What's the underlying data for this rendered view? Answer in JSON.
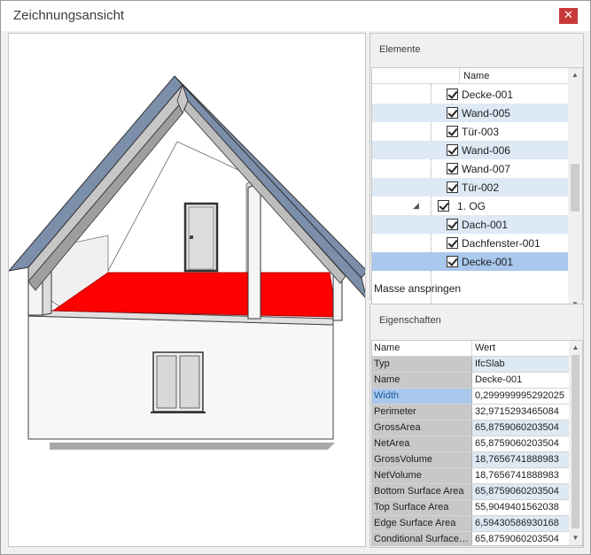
{
  "window": {
    "title": "Zeichnungsansicht",
    "close_glyph": "✕"
  },
  "colors": {
    "accent_selection": "#a9c8ec",
    "alternate_row": "#dde9f5",
    "selected_slab": "#ff0000",
    "roof": "#7b8eaa",
    "close_button": "#c8393a"
  },
  "elements": {
    "title": "Elemente",
    "column_name": "Name",
    "rows": [
      {
        "label": "Decke-001",
        "checked": true,
        "level": 2,
        "style": "plain"
      },
      {
        "label": "Wand-005",
        "checked": true,
        "level": 2,
        "style": "alt"
      },
      {
        "label": "Tür-003",
        "checked": true,
        "level": 2,
        "style": "plain"
      },
      {
        "label": "Wand-006",
        "checked": true,
        "level": 2,
        "style": "alt"
      },
      {
        "label": "Wand-007",
        "checked": true,
        "level": 2,
        "style": "plain"
      },
      {
        "label": "Tür-002",
        "checked": true,
        "level": 2,
        "style": "alt"
      },
      {
        "label": "1. OG",
        "checked": true,
        "level": 1,
        "style": "plain",
        "expander": "◢"
      },
      {
        "label": "Dach-001",
        "checked": true,
        "level": 2,
        "style": "alt"
      },
      {
        "label": "Dachfenster-001",
        "checked": true,
        "level": 2,
        "style": "plain"
      },
      {
        "label": "Decke-001",
        "checked": true,
        "level": 2,
        "style": "sel"
      }
    ],
    "jump_link": "Masse anspringen"
  },
  "properties": {
    "title": "Eigenschaften",
    "header_key": "Name",
    "header_value": "Wert",
    "rows": [
      {
        "key": "Typ",
        "value": "IfcSlab",
        "style": "lb"
      },
      {
        "key": "Name",
        "value": "Decke-001",
        "style": ""
      },
      {
        "key": "Width",
        "value": "0,299999995292025",
        "style": "hl"
      },
      {
        "key": "Perimeter",
        "value": "32,9715293465084",
        "style": ""
      },
      {
        "key": "GrossArea",
        "value": "65,8759060203504",
        "style": "lb"
      },
      {
        "key": "NetArea",
        "value": "65,8759060203504",
        "style": ""
      },
      {
        "key": "GrossVolume",
        "value": "18,7656741888983",
        "style": "lb"
      },
      {
        "key": "NetVolume",
        "value": "18,7656741888983",
        "style": ""
      },
      {
        "key": "Bottom Surface Area",
        "value": "65,8759060203504",
        "style": "lb"
      },
      {
        "key": "Top Surface Area",
        "value": "55,9049401562038",
        "style": ""
      },
      {
        "key": "Edge Surface Area",
        "value": "6,59430586930168",
        "style": "lb"
      },
      {
        "key": "Conditional Surface…",
        "value": "65,8759060203504",
        "style": ""
      }
    ]
  }
}
